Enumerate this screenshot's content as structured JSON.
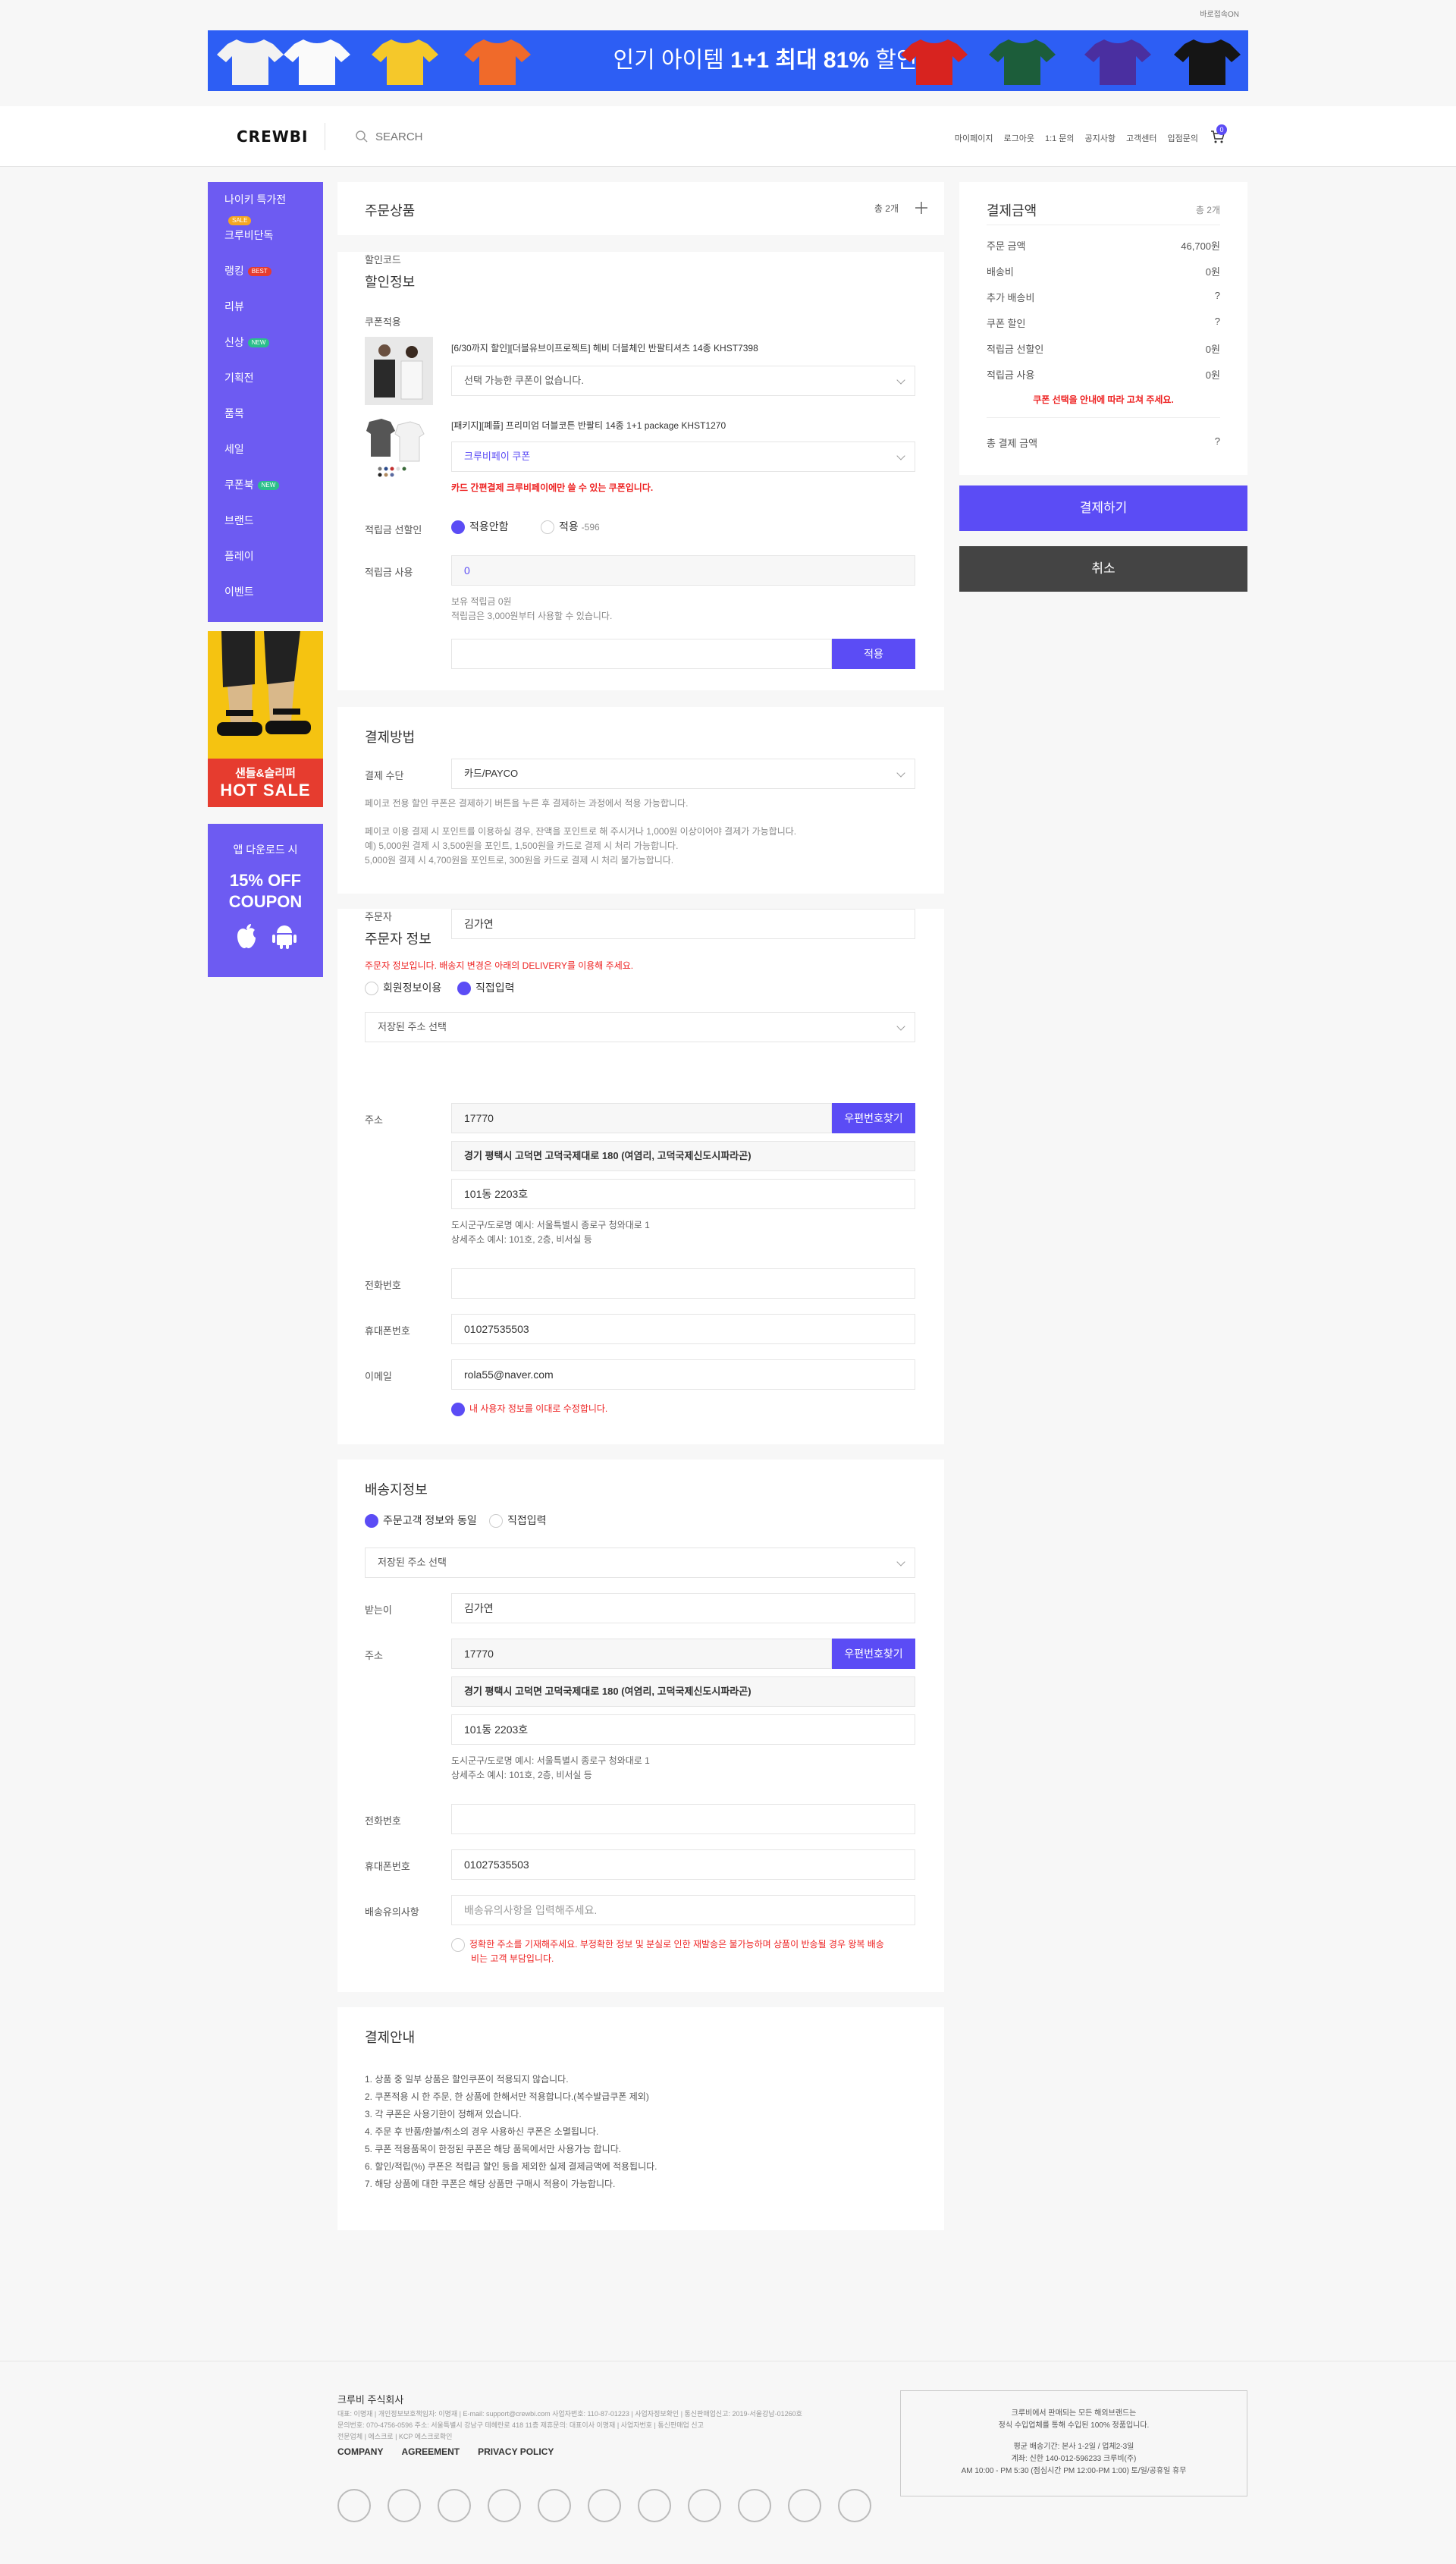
{
  "top": {
    "lang": "바로접속ON"
  },
  "banner": {
    "text_prefix": "인기 아이템 ",
    "text_bold": "1+1 최대 81%",
    "text_suffix": " 할인"
  },
  "header": {
    "logo": "CREWBI",
    "search_placeholder": "SEARCH",
    "nav": [
      "마이페이지",
      "로그아웃",
      "1:1 문의",
      "공지사항",
      "고객센터",
      "입점문의"
    ],
    "cart_count": "0"
  },
  "sidebar": {
    "items": [
      {
        "label": "나이키 특가전",
        "badge": "SALE",
        "badge_color": "#f5a623"
      },
      {
        "label": "크루비단독",
        "badge": "",
        "badge_color": ""
      },
      {
        "label": "랭킹",
        "badge": "BEST",
        "badge_color": "#e63c2f"
      },
      {
        "label": "리뷰",
        "badge": "",
        "badge_color": ""
      },
      {
        "label": "신상",
        "badge": "NEW",
        "badge_color": "#2bbf8b"
      },
      {
        "label": "기획전",
        "badge": "",
        "badge_color": ""
      },
      {
        "label": "품목",
        "badge": "",
        "badge_color": ""
      },
      {
        "label": "세일",
        "badge": "",
        "badge_color": ""
      },
      {
        "label": "쿠폰북",
        "badge": "NEW",
        "badge_color": "#2bbf8b"
      },
      {
        "label": "브랜드",
        "badge": "",
        "badge_color": ""
      },
      {
        "label": "플레이",
        "badge": "",
        "badge_color": ""
      },
      {
        "label": "이벤트",
        "badge": "",
        "badge_color": ""
      }
    ]
  },
  "ads": {
    "sandal_line1": "샌들&슬리퍼",
    "sandal_line2": "HOT SALE",
    "coupon_line1": "앱 다운로드 시",
    "coupon_line2": "15% OFF",
    "coupon_line3": "COUPON"
  },
  "order_products": {
    "title": "주문상품",
    "count": "총 2개"
  },
  "discount": {
    "title": "할인정보",
    "coupon_label": "쿠폰적용",
    "item1_name": "[6/30까지 할인][더블유브이프로젝트] 헤비 더블체인 반팔티셔츠 14종 KHST7398",
    "item1_coupon": "선택 가능한 쿠폰이 없습니다.",
    "item2_name": "[패키지][폐플] 프리미엄 더블코튼 반팔티 14종 1+1 package KHST1270",
    "item2_coupon": "크루비페이 쿠폰",
    "item2_warning": "카드 간편결제 크루비페이에만 쓸 수 있는 쿠폰입니다.",
    "points_mode_label": "적립금 선할인",
    "points_mode_opt1": "적용안함",
    "points_mode_opt2": "적용",
    "points_mode_opt2_value": "-596",
    "points_use_label": "적립금 사용",
    "points_use_value": "0",
    "points_note1": "보유 적립금 0원",
    "points_note2": "적립금은 3,000원부터 사용할 수 있습니다.",
    "code_label": "할인코드",
    "code_button": "적용"
  },
  "payment": {
    "title": "결제방법",
    "method_label": "결제 수단",
    "method_value": "카드/PAYCO",
    "note1": "페이코 전용 할인 쿠폰은 결제하기 버튼을 누른 후 결제하는 과정에서 적용 가능합니다.",
    "note2": "페이코 이용 결제 시 포인트를 이용하실 경우, 잔액을 포인트로 해 주시거나 1,000원 이상이어야 결제가 가능합니다.",
    "note3": "예) 5,000원 결제 시 3,500원을 포인트, 1,500원을 카드로 결제 시 처리 가능합니다.",
    "note4": "5,000원 결제 시 4,700원을 포인트로, 300원을 카드로 결제 시 처리 불가능합니다."
  },
  "orderer": {
    "title": "주문자 정보",
    "warning": "주문자 정보입니다. 배송지 변경은 아래의 DELIVERY를 이용해 주세요.",
    "opt1": "회원정보이용",
    "opt2": "직접입력",
    "saved_address": "저장된 주소 선택",
    "name_label": "주문자",
    "name_value": "김가연",
    "address_label": "주소",
    "zipcode": "17770",
    "zip_button": "우편번호찾기",
    "address1": "경기 평택시 고덕면 고덕국제대로 180 (여염리, 고덕국제신도시파라곤)",
    "address2": "101동 2203호",
    "address_note1": "도시군구/도로명 예시: 서울특별시 종로구 청와대로 1",
    "address_note2": "상세주소 예시: 101호, 2층, 비서실 등",
    "phone_label": "전화번호",
    "phone_value": "",
    "mobile_label": "휴대폰번호",
    "mobile_value": "01027535503",
    "email_label": "이메일",
    "email_value": "rola55@naver.com",
    "update_note": "내 사용자 정보를 이대로 수정합니다."
  },
  "shipping": {
    "title": "배송지정보",
    "opt1": "주문고객 정보와 동일",
    "opt2": "직접입력",
    "saved_address": "저장된 주소 선택",
    "name_label": "받는이",
    "name_value": "김가연",
    "address_label": "주소",
    "zipcode": "17770",
    "zip_button": "우편번호찾기",
    "address1": "경기 평택시 고덕면 고덕국제대로 180 (여염리, 고덕국제신도시파라곤)",
    "address2": "101동 2203호",
    "address_note1": "도시군구/도로명 예시: 서울특별시 종로구 청와대로 1",
    "address_note2": "상세주소 예시: 101호, 2층, 비서실 등",
    "phone_label": "전화번호",
    "phone_value": "",
    "mobile_label": "휴대폰번호",
    "mobile_value": "01027535503",
    "memo_label": "배송유의사항",
    "memo_placeholder": "배송유의사항을 입력해주세요.",
    "agree1": "정확한 주소를 기재해주세요. 부정확한 정보 및 분실로 인한 재발송은 불가능하며 상품이 반송될 경우 왕복 배송",
    "agree2": "비는 고객 부담입니다."
  },
  "guide": {
    "title": "결제안내",
    "lines": [
      "1. 상품 중 일부 상품은 할인쿠폰이 적용되지 않습니다.",
      "2. 쿠폰적용 시 한 주문, 한 상품에 한해서만 적용합니다.(복수발급쿠폰 제외)",
      "3. 각 쿠폰은 사용기한이 정해져 있습니다.",
      "4. 주문 후 반품/환불/취소의 경우 사용하신 쿠폰은 소멸됩니다.",
      "5. 쿠폰 적용품목이 한정된 쿠폰은 해당 품목에서만 사용가능 합니다.",
      "6. 할인/적립(%) 쿠폰은 적립금 할인 등을 제외한 실제 결제금액에 적용됩니다.",
      "7. 해당 상품에 대한 쿠폰은 해당 상품만 구매시 적용이 가능합니다."
    ]
  },
  "summary": {
    "title": "결제금액",
    "count": "총 2개",
    "rows": [
      {
        "label": "주문 금액",
        "value": "46,700원",
        "red": false
      },
      {
        "label": "배송비",
        "value": "0원",
        "red": false
      },
      {
        "label": "추가 배송비",
        "value": "?",
        "red": true
      },
      {
        "label": "쿠폰 할인",
        "value": "?",
        "red": true
      },
      {
        "label": "적립금 선할인",
        "value": "0원",
        "red": false
      },
      {
        "label": "적립금 사용",
        "value": "0원",
        "red": false
      }
    ],
    "coupon_notice": "쿠폰 선택을 안내에 따라 고쳐 주세요.",
    "total_label": "총 결제 금액",
    "total_value": "?",
    "pay_button": "결제하기",
    "cancel_button": "취소"
  },
  "footer": {
    "company": "크루비 주식회사",
    "info1": "대표: 이명재 | 개인정보보호책임자: 이명재 | E-mail: support@crewbi.com 사업자번호: 110-87-01223 | 사업자정보확인 | 통신판매업신고: 2019-서울강남-01260호",
    "info2": "문의번호: 070-4756-0596 주소: 서울특별시 강남구 테헤란로 418 11층 제휴문의: 대표이사 이명재 | 사업자번호 | 통신판매업 신고",
    "info3": "전문업체 | 에스크로 | KCP 에스크로확인",
    "links": [
      "COMPANY",
      "AGREEMENT",
      "PRIVACY POLICY"
    ],
    "box1": "크루비에서 판매되는 모든 해외브랜드는",
    "box2": "정식 수입업체를 통해 수입된 100% 정품입니다.",
    "box3": "평균 배송기간: 본사 1-2일 / 업체2-3일",
    "box4": "계좌: 신한 140-012-596233 크루비(주)",
    "box5": "AM 10:00 - PM 5:30 (점심시간 PM 12:00-PM 1:00) 토/일/공휴일 휴무"
  },
  "colors": {
    "accent": "#5b4cf5",
    "sidebar": "#6d5bf2",
    "warning": "#e22222",
    "banner": "#2d5ef4"
  }
}
